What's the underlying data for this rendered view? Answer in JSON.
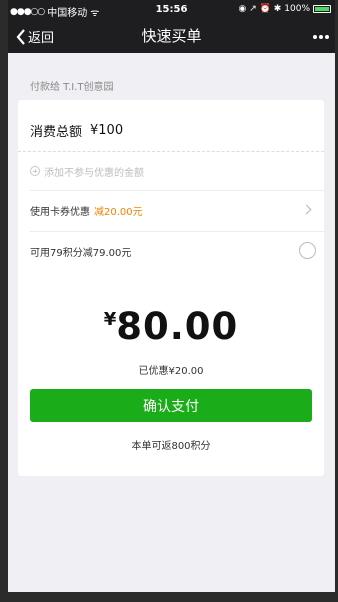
{
  "status_bar": {
    "signal": "●●●○○",
    "carrier": "中国移动",
    "wifi": "ᯤ",
    "time": "15:56",
    "icons": "◉ ↗ ⏰ ✱",
    "battery_text": "100%",
    "battery_color": "#4cd964"
  },
  "nav": {
    "back_label": "返回",
    "title": "快速买单"
  },
  "merchant": {
    "label": "付款给 T.I.T创意园"
  },
  "bill": {
    "total_label": "消费总额",
    "total_value": "¥100",
    "add_label": "添加不参与优惠的金额",
    "coupon_label": "使用卡券优惠",
    "coupon_discount": "减20.00元",
    "points_label": "可用79积分减79.00元"
  },
  "payment": {
    "currency": "¥",
    "amount": "80.00",
    "saved_text": "已优惠¥20.00",
    "pay_button": "确认支付",
    "rebate_text": "本单可返800积分"
  },
  "colors": {
    "accent_green": "#1aad19",
    "discount_orange": "#f08300",
    "navbar": "#1e1e20"
  }
}
